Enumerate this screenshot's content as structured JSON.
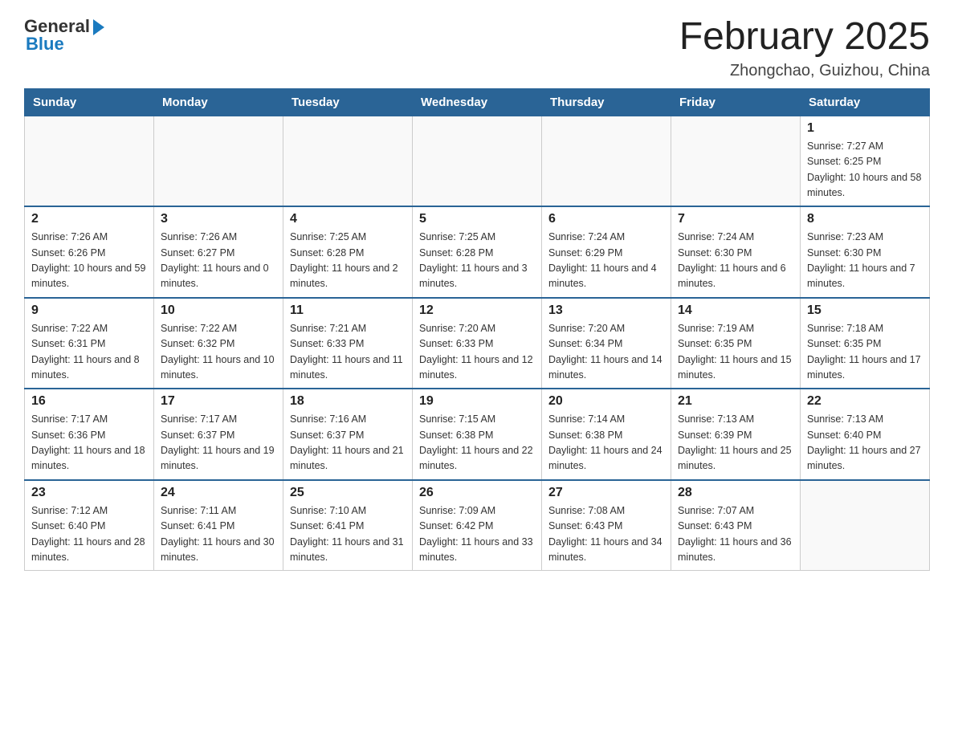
{
  "logo": {
    "general": "General",
    "blue": "Blue"
  },
  "header": {
    "month": "February 2025",
    "location": "Zhongchao, Guizhou, China"
  },
  "days_of_week": [
    "Sunday",
    "Monday",
    "Tuesday",
    "Wednesday",
    "Thursday",
    "Friday",
    "Saturday"
  ],
  "weeks": [
    [
      {
        "day": "",
        "sunrise": "",
        "sunset": "",
        "daylight": ""
      },
      {
        "day": "",
        "sunrise": "",
        "sunset": "",
        "daylight": ""
      },
      {
        "day": "",
        "sunrise": "",
        "sunset": "",
        "daylight": ""
      },
      {
        "day": "",
        "sunrise": "",
        "sunset": "",
        "daylight": ""
      },
      {
        "day": "",
        "sunrise": "",
        "sunset": "",
        "daylight": ""
      },
      {
        "day": "",
        "sunrise": "",
        "sunset": "",
        "daylight": ""
      },
      {
        "day": "1",
        "sunrise": "Sunrise: 7:27 AM",
        "sunset": "Sunset: 6:25 PM",
        "daylight": "Daylight: 10 hours and 58 minutes."
      }
    ],
    [
      {
        "day": "2",
        "sunrise": "Sunrise: 7:26 AM",
        "sunset": "Sunset: 6:26 PM",
        "daylight": "Daylight: 10 hours and 59 minutes."
      },
      {
        "day": "3",
        "sunrise": "Sunrise: 7:26 AM",
        "sunset": "Sunset: 6:27 PM",
        "daylight": "Daylight: 11 hours and 0 minutes."
      },
      {
        "day": "4",
        "sunrise": "Sunrise: 7:25 AM",
        "sunset": "Sunset: 6:28 PM",
        "daylight": "Daylight: 11 hours and 2 minutes."
      },
      {
        "day": "5",
        "sunrise": "Sunrise: 7:25 AM",
        "sunset": "Sunset: 6:28 PM",
        "daylight": "Daylight: 11 hours and 3 minutes."
      },
      {
        "day": "6",
        "sunrise": "Sunrise: 7:24 AM",
        "sunset": "Sunset: 6:29 PM",
        "daylight": "Daylight: 11 hours and 4 minutes."
      },
      {
        "day": "7",
        "sunrise": "Sunrise: 7:24 AM",
        "sunset": "Sunset: 6:30 PM",
        "daylight": "Daylight: 11 hours and 6 minutes."
      },
      {
        "day": "8",
        "sunrise": "Sunrise: 7:23 AM",
        "sunset": "Sunset: 6:30 PM",
        "daylight": "Daylight: 11 hours and 7 minutes."
      }
    ],
    [
      {
        "day": "9",
        "sunrise": "Sunrise: 7:22 AM",
        "sunset": "Sunset: 6:31 PM",
        "daylight": "Daylight: 11 hours and 8 minutes."
      },
      {
        "day": "10",
        "sunrise": "Sunrise: 7:22 AM",
        "sunset": "Sunset: 6:32 PM",
        "daylight": "Daylight: 11 hours and 10 minutes."
      },
      {
        "day": "11",
        "sunrise": "Sunrise: 7:21 AM",
        "sunset": "Sunset: 6:33 PM",
        "daylight": "Daylight: 11 hours and 11 minutes."
      },
      {
        "day": "12",
        "sunrise": "Sunrise: 7:20 AM",
        "sunset": "Sunset: 6:33 PM",
        "daylight": "Daylight: 11 hours and 12 minutes."
      },
      {
        "day": "13",
        "sunrise": "Sunrise: 7:20 AM",
        "sunset": "Sunset: 6:34 PM",
        "daylight": "Daylight: 11 hours and 14 minutes."
      },
      {
        "day": "14",
        "sunrise": "Sunrise: 7:19 AM",
        "sunset": "Sunset: 6:35 PM",
        "daylight": "Daylight: 11 hours and 15 minutes."
      },
      {
        "day": "15",
        "sunrise": "Sunrise: 7:18 AM",
        "sunset": "Sunset: 6:35 PM",
        "daylight": "Daylight: 11 hours and 17 minutes."
      }
    ],
    [
      {
        "day": "16",
        "sunrise": "Sunrise: 7:17 AM",
        "sunset": "Sunset: 6:36 PM",
        "daylight": "Daylight: 11 hours and 18 minutes."
      },
      {
        "day": "17",
        "sunrise": "Sunrise: 7:17 AM",
        "sunset": "Sunset: 6:37 PM",
        "daylight": "Daylight: 11 hours and 19 minutes."
      },
      {
        "day": "18",
        "sunrise": "Sunrise: 7:16 AM",
        "sunset": "Sunset: 6:37 PM",
        "daylight": "Daylight: 11 hours and 21 minutes."
      },
      {
        "day": "19",
        "sunrise": "Sunrise: 7:15 AM",
        "sunset": "Sunset: 6:38 PM",
        "daylight": "Daylight: 11 hours and 22 minutes."
      },
      {
        "day": "20",
        "sunrise": "Sunrise: 7:14 AM",
        "sunset": "Sunset: 6:38 PM",
        "daylight": "Daylight: 11 hours and 24 minutes."
      },
      {
        "day": "21",
        "sunrise": "Sunrise: 7:13 AM",
        "sunset": "Sunset: 6:39 PM",
        "daylight": "Daylight: 11 hours and 25 minutes."
      },
      {
        "day": "22",
        "sunrise": "Sunrise: 7:13 AM",
        "sunset": "Sunset: 6:40 PM",
        "daylight": "Daylight: 11 hours and 27 minutes."
      }
    ],
    [
      {
        "day": "23",
        "sunrise": "Sunrise: 7:12 AM",
        "sunset": "Sunset: 6:40 PM",
        "daylight": "Daylight: 11 hours and 28 minutes."
      },
      {
        "day": "24",
        "sunrise": "Sunrise: 7:11 AM",
        "sunset": "Sunset: 6:41 PM",
        "daylight": "Daylight: 11 hours and 30 minutes."
      },
      {
        "day": "25",
        "sunrise": "Sunrise: 7:10 AM",
        "sunset": "Sunset: 6:41 PM",
        "daylight": "Daylight: 11 hours and 31 minutes."
      },
      {
        "day": "26",
        "sunrise": "Sunrise: 7:09 AM",
        "sunset": "Sunset: 6:42 PM",
        "daylight": "Daylight: 11 hours and 33 minutes."
      },
      {
        "day": "27",
        "sunrise": "Sunrise: 7:08 AM",
        "sunset": "Sunset: 6:43 PM",
        "daylight": "Daylight: 11 hours and 34 minutes."
      },
      {
        "day": "28",
        "sunrise": "Sunrise: 7:07 AM",
        "sunset": "Sunset: 6:43 PM",
        "daylight": "Daylight: 11 hours and 36 minutes."
      },
      {
        "day": "",
        "sunrise": "",
        "sunset": "",
        "daylight": ""
      }
    ]
  ]
}
